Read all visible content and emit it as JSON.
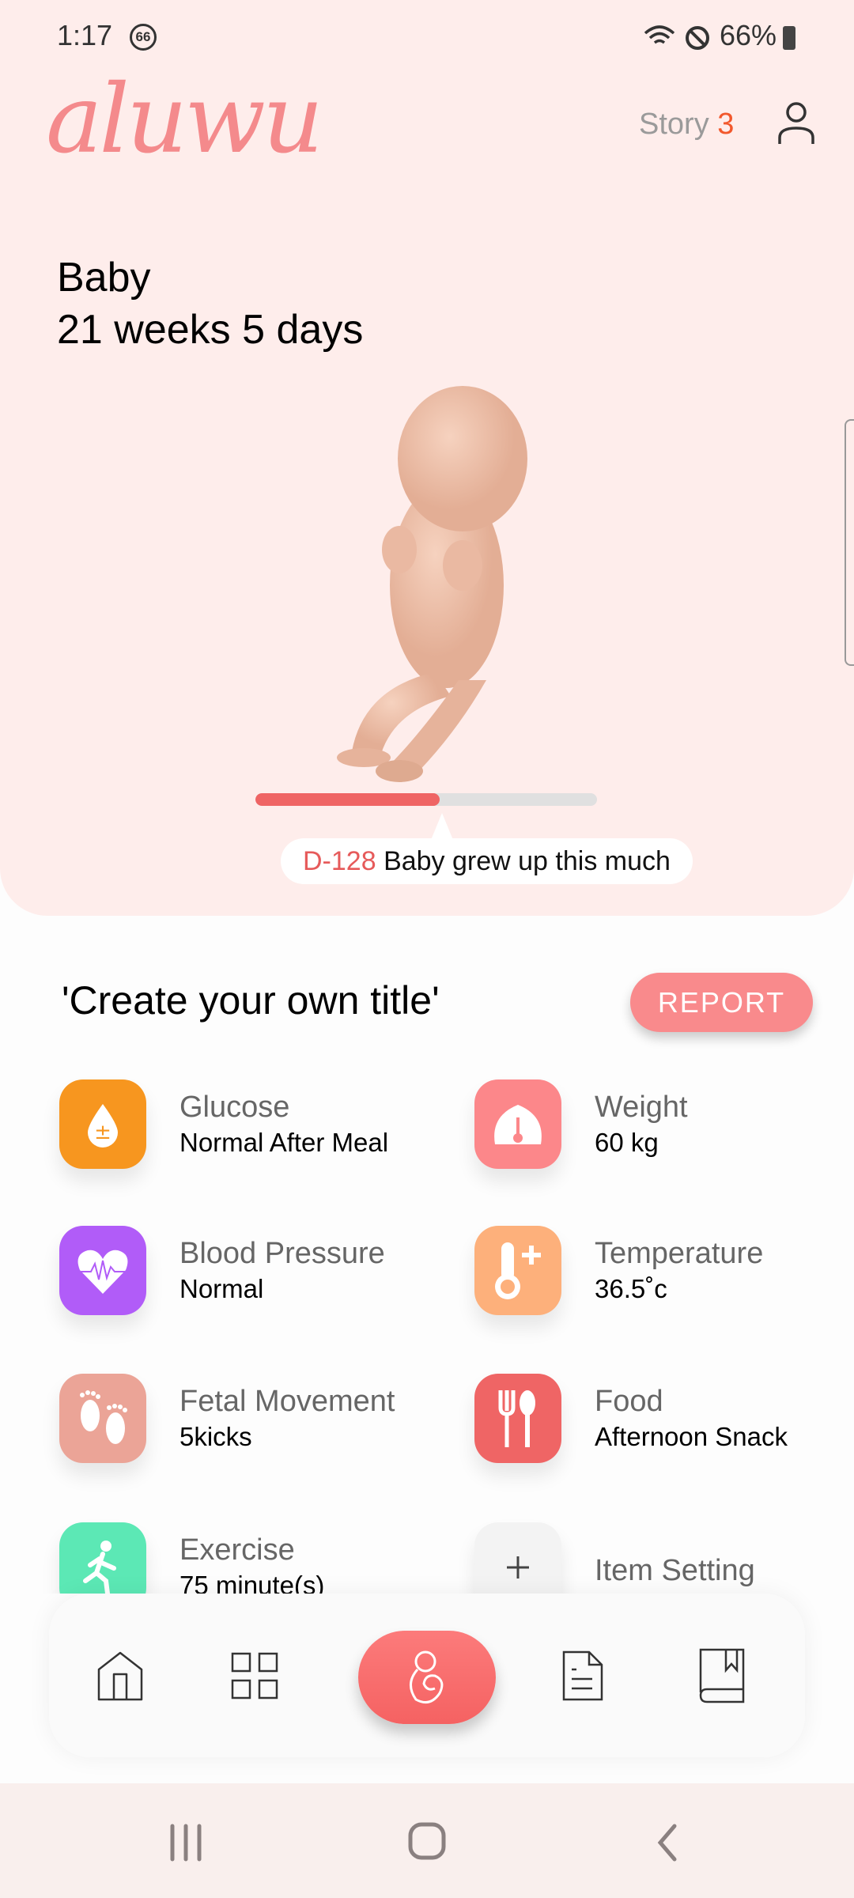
{
  "status_bar": {
    "time": "1:17",
    "notification_badge": "66",
    "battery": "66%"
  },
  "header": {
    "logo": "aluwu",
    "story_label": "Story",
    "story_count": "3"
  },
  "baby": {
    "name": "Baby",
    "age": "21 weeks 5 days",
    "progress_percent": 54,
    "countdown": "D-128",
    "progress_text": "Baby grew up this much"
  },
  "section": {
    "title": "'Create your own title'",
    "report_label": "REPORT"
  },
  "items": [
    {
      "label": "Glucose",
      "value": "Normal After Meal",
      "icon": "glucose-drop-icon",
      "color": "#f7961f"
    },
    {
      "label": "Weight",
      "value": "60 kg",
      "icon": "scale-icon",
      "color": "#fc878a"
    },
    {
      "label": "Blood Pressure",
      "value": "Normal",
      "icon": "heart-pulse-icon",
      "color": "#b15cf8"
    },
    {
      "label": "Temperature",
      "value": "36.5˚c",
      "icon": "thermometer-icon",
      "color": "#fdb07b"
    },
    {
      "label": "Fetal Movement",
      "value": "5kicks",
      "icon": "footprints-icon",
      "color": "#eba497"
    },
    {
      "label": "Food",
      "value": "Afternoon Snack",
      "icon": "fork-spoon-icon",
      "color": "#ef6565"
    },
    {
      "label": "Exercise",
      "value": "75 minute(s)",
      "icon": "running-icon",
      "color": "#5ce8b5"
    },
    {
      "label": "Item Setting",
      "value": "",
      "icon": "plus-icon",
      "color": "#f3f3f3"
    }
  ],
  "bottom_nav": [
    "home",
    "grid",
    "baby",
    "document",
    "book"
  ]
}
